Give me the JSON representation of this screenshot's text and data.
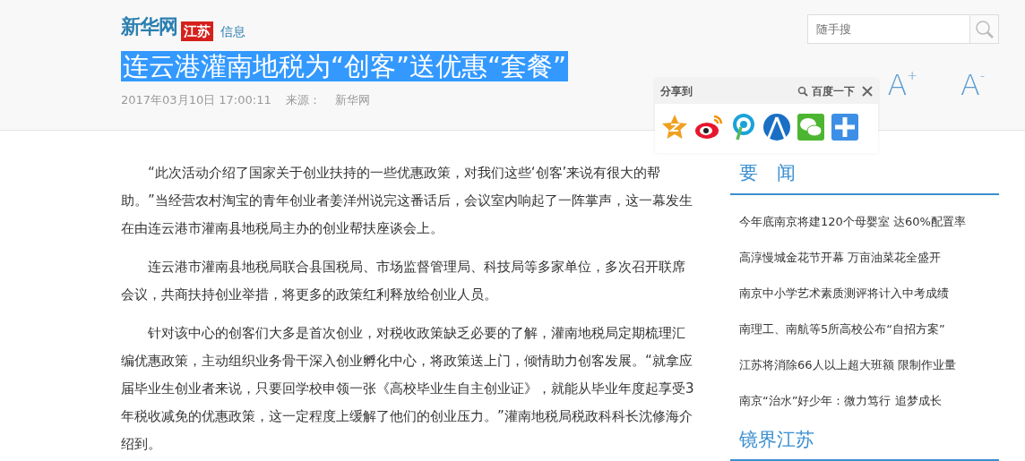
{
  "header": {
    "brand": "新华网",
    "region": "江苏",
    "section": "信息"
  },
  "search": {
    "placeholder": "随手搜"
  },
  "title": {
    "text": "连云港灌南地税为“创客”送优惠“套餐”",
    "selected": true
  },
  "meta": {
    "date": "2017年03月10日 17:00:11",
    "source_label": "来源：",
    "source": "新华网"
  },
  "font_buttons": [
    "A$^{+}$",
    "A$^{-}$"
  ],
  "share_popup": {
    "label": "分享到",
    "search_label": "百度一下",
    "targets": [
      {
        "kind": "star"
      },
      {
        "kind": "eye"
      },
      {
        "kind": "pin"
      },
      {
        "kind": "circle"
      },
      {
        "kind": "chat"
      },
      {
        "kind": "plus"
      }
    ]
  },
  "paragraphs": [
    "“此次活动介绍了国家关于创业扶持的一些优惠政策，对我们这些‘创客’来说有很大的帮助。”当经营农村淘宝的青年创业者姜洋州说完这番话后，会议室内响起了一阵掌声，这一幕发生在由连云港市灌南县地税局主办的创业帮扶座谈会上。",
    "连云港市灌南县地税局联合县国税局、市场监督管理局、科技局等多家单位，多次召开联席会议，共商扶持创业举措，将更多的政策红利释放给创业人员。",
    "针对该中心的创客们大多是首次创业，对税收政策缺乏必要的了解，灌南地税局定期梳理汇编优惠政策，主动组织业务骨干深入创业孵化中心，将政策送上门，倾情助力创客发展。“就拿应届毕业生创业者来说，只要回学校申领一张《高校毕业生自主创业证》，就能从毕业年度起享受3年税收减免的优惠政策，这一定程度上缓解了他们的创业压力。”灌南地税局税政科科长沈修海介绍到。"
  ],
  "sidebar": [
    {
      "title": "要　闻",
      "items": [
        "今年底南京将建120个母婴室 达60%配置率",
        "高淳慢城金花节开幕 万亩油菜花全盛开",
        "南京中小学艺术素质测评将计入中考成绩",
        "南理工、南航等5所高校公布“自招方案”",
        "江苏将消除66人以上超大班额 限制作业量",
        "南京“治水”好少年：微力笃行 追梦成长"
      ]
    },
    {
      "title": "镜界江苏"
    }
  ]
}
